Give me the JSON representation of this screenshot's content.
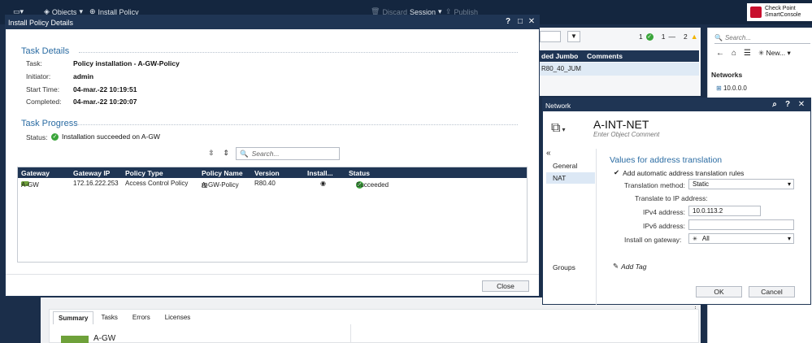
{
  "topbar": {
    "objects_label": "Objects",
    "install_policy_label": "Install Policy",
    "discard_label": "Discard",
    "session_label": "Session",
    "publish_label": "Publish",
    "brand_line1": "Check Point",
    "brand_line2": "SmartConsole"
  },
  "bg_center": {
    "counts": [
      "1",
      "1",
      "2"
    ],
    "col_jumbo": "ded Jumbo",
    "col_comments": "Comments",
    "cell": "R80_40_JUM"
  },
  "bg_right": {
    "search_placeholder": "Search...",
    "new_label": "New...",
    "section": "Networks",
    "item": "10.0.0.0"
  },
  "bottom_tabs": [
    "Summary",
    "Tasks",
    "Errors",
    "Licenses"
  ],
  "bottom_partial": "A-GW",
  "install_dialog": {
    "title": "Install Policy Details",
    "task_details_h": "Task Details",
    "task_label": "Task:",
    "task_value": "Policy installation - A-GW-Policy",
    "initiator_label": "Initiator:",
    "initiator_value": "admin",
    "start_label": "Start Time:",
    "start_value": "04-mar.-22 10:19:51",
    "completed_label": "Completed:",
    "completed_value": "04-mar.-22 10:20:07",
    "task_progress_h": "Task Progress",
    "status_label": "Status:",
    "status_value": "Installation succeeded on A-GW",
    "search_placeholder": "Search...",
    "columns": [
      "Gateway",
      "Gateway IP",
      "Policy Type",
      "Policy Name",
      "Version",
      "Install...",
      "Status"
    ],
    "rows": [
      {
        "gateway": "A-GW",
        "ip": "172.16.222.253",
        "type": "Access Control Policy",
        "name": "A-GW-Policy",
        "version": "R80.40",
        "status": "Succeeded"
      }
    ],
    "close_label": "Close"
  },
  "network_dialog": {
    "title": "Network",
    "name": "A-INT-NET",
    "comment_placeholder": "Enter Object Comment",
    "nav": [
      "General",
      "NAT",
      "Groups"
    ],
    "nat_h": "Values for address translation",
    "auto_nat_label": "Add automatic address translation rules",
    "method_label": "Translation method:",
    "method_value": "Static",
    "translate_label": "Translate to IP address:",
    "ipv4_label": "IPv4 address:",
    "ipv4_value": "10.0.113.2",
    "ipv6_label": "IPv6 address:",
    "ipv6_value": "",
    "install_on_label": "Install on gateway:",
    "install_on_value": "All",
    "add_tag_label": "Add Tag",
    "ok_label": "OK",
    "cancel_label": "Cancel"
  },
  "colors": {
    "header_navy": "#1f3554",
    "accent_blue": "#2b6ca3",
    "success_green": "#3aa53a",
    "warning_yellow": "#f2b400"
  }
}
